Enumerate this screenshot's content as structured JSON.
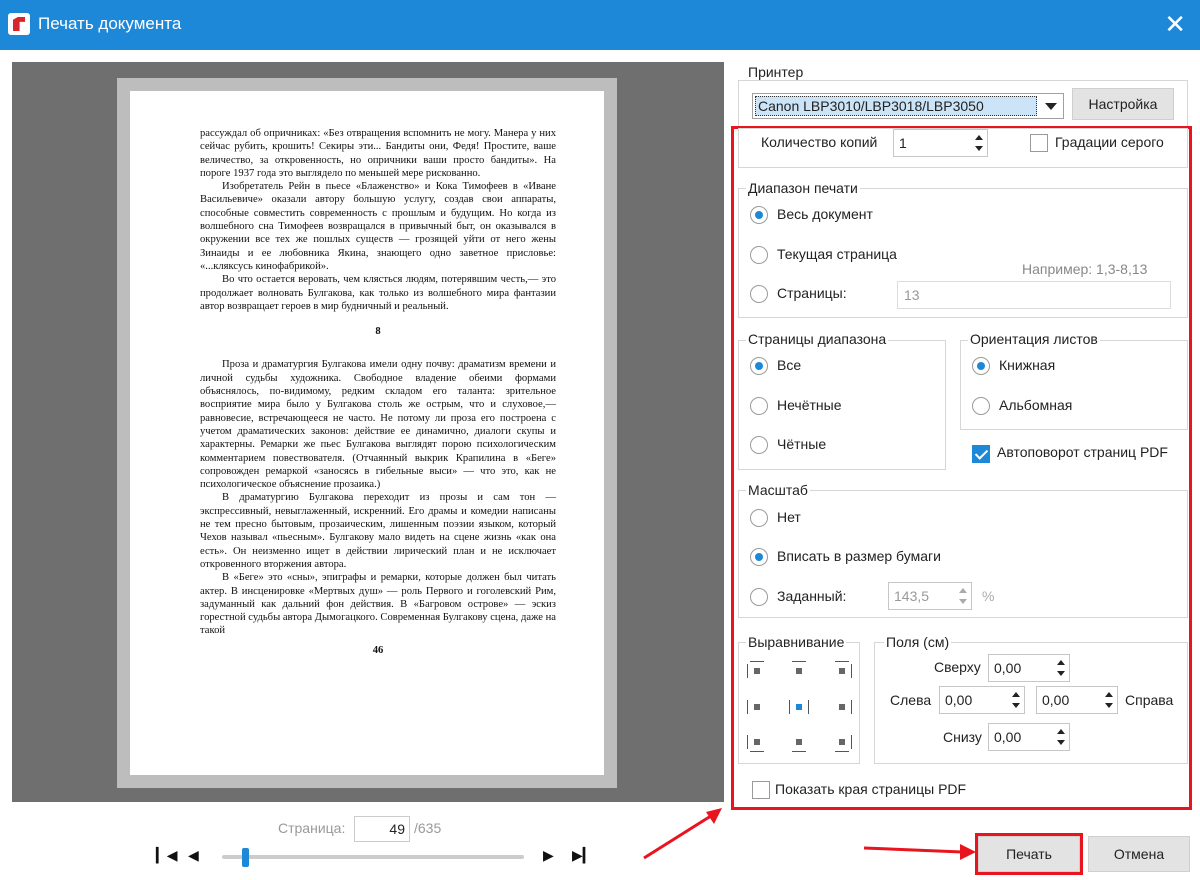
{
  "window": {
    "title": "Печать документа"
  },
  "preview": {
    "paragraphs": [
      "рассуждал об опричниках: «Без отвращения вспомнить не могу. Манера у них сейчас рубить, крошить! Секиры эти... Бандиты они, Федя! Простите, ваше величество, за откровенность, но опричники ваши просто бандиты». На пороге 1937 года это выглядело по меньшей мере рискованно.",
      "Изобретатель Рейн в пьесе «Блаженство» и Кока Тимофеев в «Иване Васильевиче» оказали автору большую услугу, создав свои аппараты, способные совместить современность с прошлым и будущим. Но когда из волшебного сна Тимофеев возвращался в привычный быт, он оказывался в окружении все тех же пошлых существ — грозящей уйти от него жены Зинаиды и ее любовника Якина, знающего одно заветное присловье: «...кляксусь кинофабрикой».",
      "Во что остается веровать, чем клясться людям, потерявшим честь,— это продолжает волновать Булгакова, как только из волшебного мира фантазии автор возвращает героев в мир будничный и реальный."
    ],
    "chapter_number": "8",
    "paragraphs2": [
      "Проза и драматургия Булгакова имели одну почву: драматизм времени и личной судьбы художника. Свободное владение обеими формами объяснялось, по-видимому, редким складом его таланта: зрительное восприятие мира было у Булгакова столь же острым, что и слуховое,— равновесие, встречающееся не часто. Не потому ли проза его построена с учетом драматических законов: действие ее динамично, диалоги скупы и характерны. Ремарки же пьес Булгакова выглядят порою психологическим комментарием повествователя. (Отчаянный выкрик Крапилина в «Беге» сопровожден ремаркой «заносясь в гибельные выси» — что это, как не психологическое объяснение прозаика.)",
      "В драматургию Булгакова переходит из прозы и сам тон — экспрессивный, невыглаженный, искренний. Его драмы и комедии написаны не тем пресно бытовым, прозаическим, лишенным поэзии языком, который Чехов называл «пьесным». Булгакову мало видеть на сцене жизнь «как она есть». Он неизменно ищет в действии лирический план и не исключает откровенного вторжения автора.",
      "В «Беге» это «сны», эпиграфы и ремарки, которые должен был читать актер. В инсценировке «Мертвых душ» — роль Первого и гоголевский Рим, задуманный как дальний фон действия. В «Багровом острове» — эскиз горестной судьбы автора Дымогацкого. Современная Булгакову сцена, даже на такой"
    ],
    "page_footer_number": "46"
  },
  "pager": {
    "label": "Страница:",
    "current": "49",
    "total": "/635",
    "position_fraction": 0.077
  },
  "printer": {
    "group_label": "Принтер",
    "selected": "Canon LBP3010/LBP3018/LBP3050",
    "settings_button": "Настройка"
  },
  "copies": {
    "label": "Количество копий",
    "value": "1"
  },
  "grayscale": {
    "label": "Градации серого",
    "checked": false
  },
  "range": {
    "group_label": "Диапазон печати",
    "options": [
      "Весь документ",
      "Текущая страница",
      "Страницы:"
    ],
    "selected_index": 0,
    "example_hint": "Например: 1,3-8,13",
    "pages_value": "13"
  },
  "range_pages": {
    "group_label": "Страницы диапазона",
    "options": [
      "Все",
      "Нечётные",
      "Чётные"
    ],
    "selected_index": 0
  },
  "orientation": {
    "group_label": "Ориентация листов",
    "options": [
      "Книжная",
      "Альбомная"
    ],
    "selected_index": 0
  },
  "autorotate": {
    "label": "Автоповорот страниц PDF",
    "checked": true
  },
  "scale": {
    "group_label": "Масштаб",
    "options": [
      "Нет",
      "Вписать в размер бумаги",
      "Заданный:"
    ],
    "selected_index": 1,
    "custom_value": "143,5",
    "unit": "%"
  },
  "alignment": {
    "group_label": "Выравнивание",
    "selected": "center"
  },
  "margins": {
    "group_label": "Поля (см)",
    "top_label": "Сверху",
    "top": "0,00",
    "left_label": "Слева",
    "left": "0,00",
    "right_label": "Справа",
    "right": "0,00",
    "bottom_label": "Снизу",
    "bottom": "0,00"
  },
  "show_edges": {
    "label": "Показать края страницы PDF",
    "checked": false
  },
  "actions": {
    "print": "Печать",
    "cancel": "Отмена"
  },
  "colors": {
    "accent": "#1e88d8",
    "highlight": "#e8141e"
  }
}
